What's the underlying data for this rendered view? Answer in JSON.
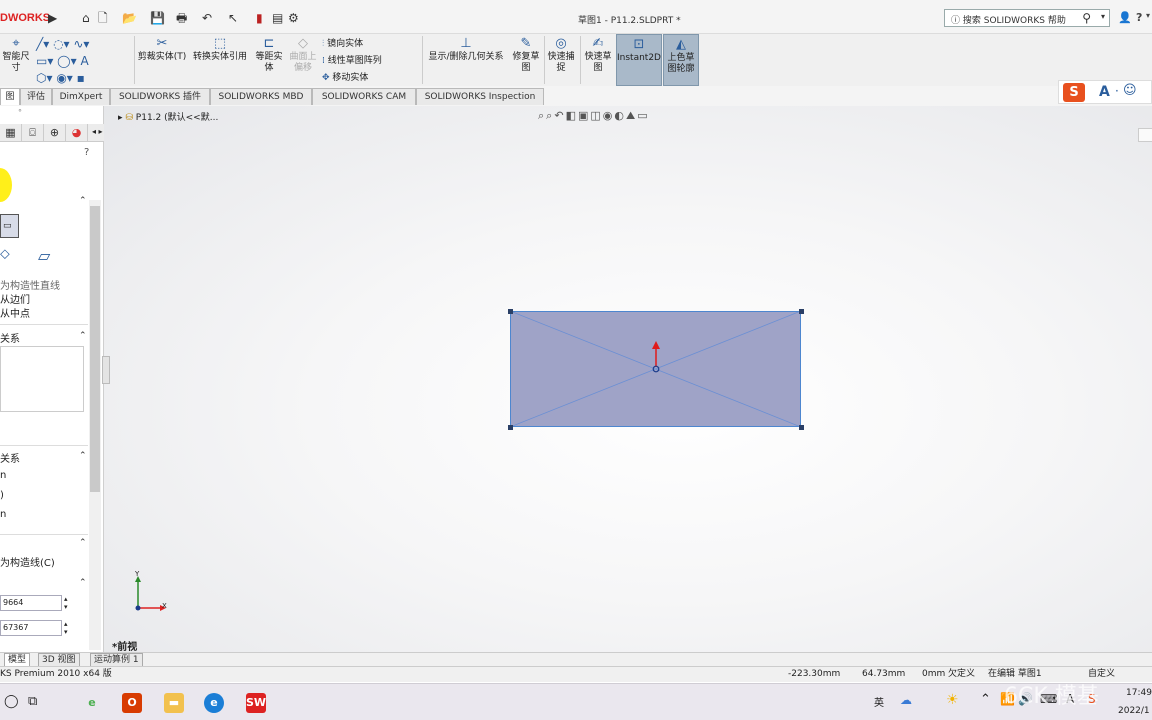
{
  "app": {
    "logo": "DWORKS",
    "document_title": "草图1 - P11.2.SLDPRT *"
  },
  "help": {
    "search_placeholder": "搜索 SOLIDWORKS 帮助"
  },
  "title_right": {
    "user_icon": "user-icon",
    "help_icon": "?",
    "help_drop": "▾"
  },
  "command_manager": {
    "items": [
      {
        "label": "智能尺寸",
        "icon": "smart-dimension-icon"
      },
      {
        "label": "剪裁实体(T)",
        "icon": "trim-icon"
      },
      {
        "label": "转换实体引用",
        "icon": "convert-icon"
      },
      {
        "label": "等距实体",
        "icon": "offset-icon"
      },
      {
        "label": "曲面上偏移",
        "icon": "surface-offset-icon"
      },
      {
        "label": "镜向实体",
        "icon": "mirror-icon"
      },
      {
        "label": "线性草图阵列",
        "icon": "linear-pattern-icon"
      },
      {
        "label": "移动实体",
        "icon": "move-icon"
      },
      {
        "label": "显示/删除几何关系",
        "icon": "relations-icon"
      },
      {
        "label": "修复草图",
        "icon": "repair-icon"
      },
      {
        "label": "快速捕捉",
        "icon": "snap-icon"
      },
      {
        "label": "快速草图",
        "icon": "rapid-sketch-icon"
      },
      {
        "label": "Instant2D",
        "icon": "instant2d-icon"
      },
      {
        "label": "上色草图轮廓",
        "icon": "shaded-sketch-icon"
      }
    ]
  },
  "tabs": [
    "图",
    "评估",
    "DimXpert",
    "SOLIDWORKS 插件",
    "SOLIDWORKS MBD",
    "SOLIDWORKS CAM",
    "SOLIDWORKS Inspection"
  ],
  "left_panel": {
    "help_mark": "?",
    "option1": "为构造性直线",
    "option2": "从边们",
    "option3": "从中点",
    "section_relations": "关系",
    "section_params": "关系",
    "param_a": "n",
    "param_b": ")",
    "param_c": "n",
    "construction": "为构造线(C)",
    "field1": "9664",
    "field2": "67367"
  },
  "viewport": {
    "tree_item": "P11.2 (默认<<默...",
    "view_label": "*前视",
    "axis_x": "X",
    "axis_y": "Y"
  },
  "bottom_tabs": [
    "模型",
    "3D 视图",
    "运动算例 1"
  ],
  "status": {
    "product": "KS Premium 2010 x64 版",
    "x": "-223.30mm",
    "y": "64.73mm",
    "z": "0mm",
    "state1": "欠定义",
    "state2": "在编辑 草图1",
    "units": "自定义"
  },
  "taskbar": {
    "lang": "英",
    "time": "17:49",
    "date": "2022/1"
  },
  "sogou": {
    "brand": "S",
    "a": "A",
    "extra": "☺"
  },
  "watermark": "6CK 模基",
  "colors": {
    "sketch_fill": "#9fa3c7",
    "sketch_edge": "#4d86cf",
    "instant2d_bg": "#a9b9c9",
    "logo_red": "#d22222"
  }
}
